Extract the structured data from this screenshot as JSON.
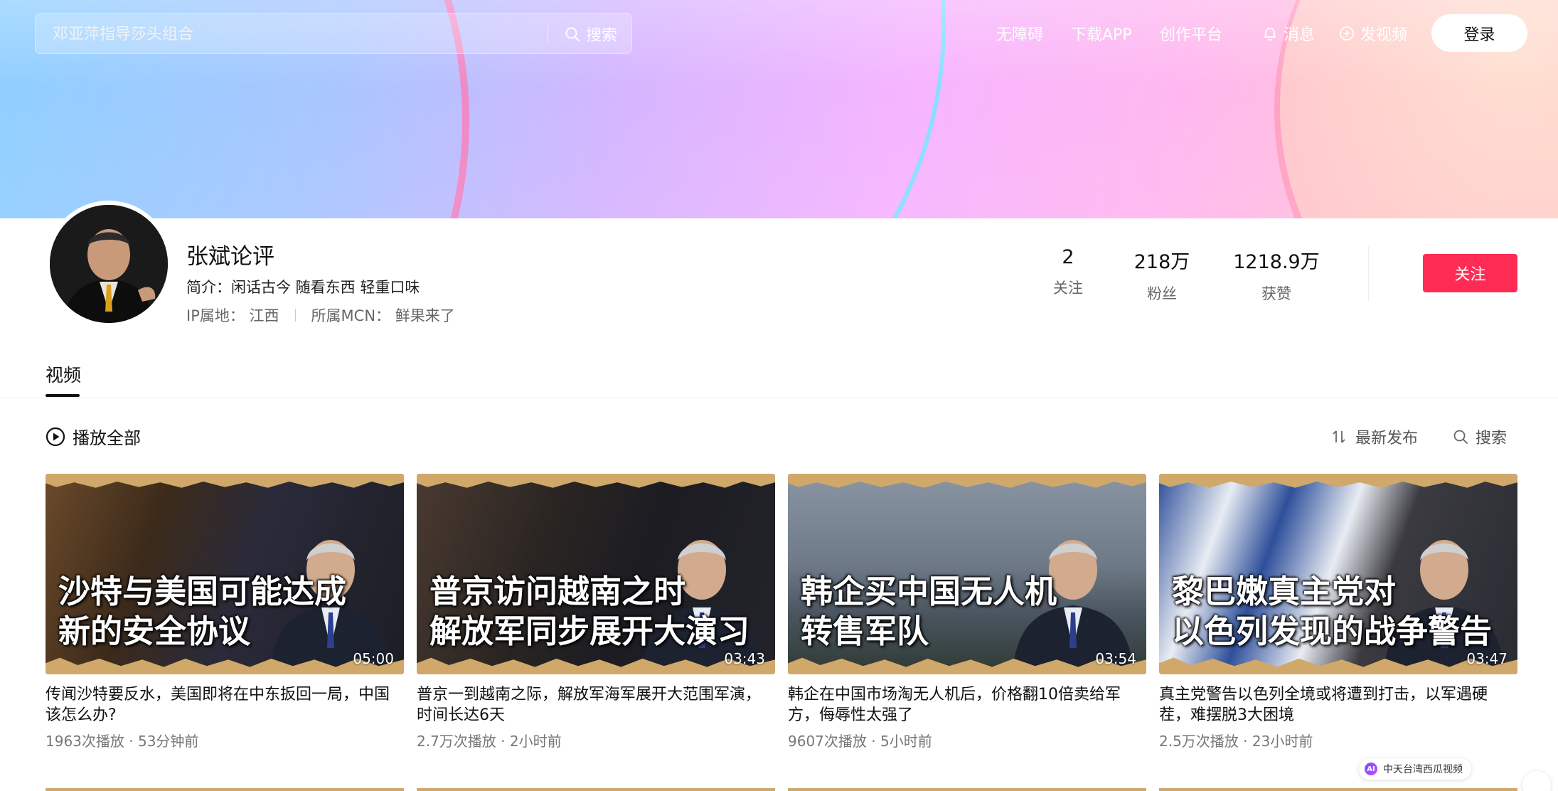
{
  "search": {
    "placeholder": "邓亚萍指导莎头组合",
    "button_label": "搜索"
  },
  "nav": {
    "accessibility": "无障碍",
    "download_app": "下载APP",
    "creator_platform": "创作平台",
    "messages": "消息",
    "upload": "发视频",
    "login": "登录"
  },
  "profile": {
    "name": "张斌论评",
    "bio": "简介：闲话古今 随看东西 轻重口味",
    "ip_location": "IP属地：  江西",
    "mcn": "所属MCN：  鲜果来了",
    "stats": [
      {
        "value": "2",
        "label": "关注"
      },
      {
        "value": "218万",
        "label": "粉丝"
      },
      {
        "value": "1218.9万",
        "label": "获赞"
      }
    ],
    "follow_label": "关注"
  },
  "tabs": {
    "videos": "视频"
  },
  "toolbar": {
    "play_all": "播放全部",
    "sort": "最新发布",
    "search": "搜索"
  },
  "videos": [
    {
      "overlay_line1": "沙特与美国可能达成",
      "overlay_line2": "新的安全协议",
      "duration": "05:00",
      "title": "传闻沙特要反水，美国即将在中东扳回一局，中国该怎么办?",
      "stats": "1963次播放 · 53分钟前"
    },
    {
      "overlay_line1": "普京访问越南之时",
      "overlay_line2": "解放军同步展开大演习",
      "duration": "03:43",
      "title": "普京一到越南之际，解放军海军展开大范围军演，时间长达6天",
      "stats": "2.7万次播放 · 2小时前"
    },
    {
      "overlay_line1": "韩企买中国无人机",
      "overlay_line2": "转售军队",
      "duration": "03:54",
      "title": "韩企在中国市场淘无人机后，价格翻10倍卖给军方，侮辱性太强了",
      "stats": "9607次播放 · 5小时前"
    },
    {
      "overlay_line1": "黎巴嫩真主党对",
      "overlay_line2": "以色列发现的战争警告",
      "duration": "03:47",
      "title": "真主党警告以色列全境或将遭到打击，以军遇硬茬，难摆脱3大困境",
      "stats": "2.5万次播放 · 23小时前"
    }
  ],
  "floating_tag": {
    "badge": "AI",
    "label": "中天台湾西瓜视频"
  },
  "colors": {
    "accent": "#fe2c55",
    "thumb_frame": "#cfa86a"
  }
}
